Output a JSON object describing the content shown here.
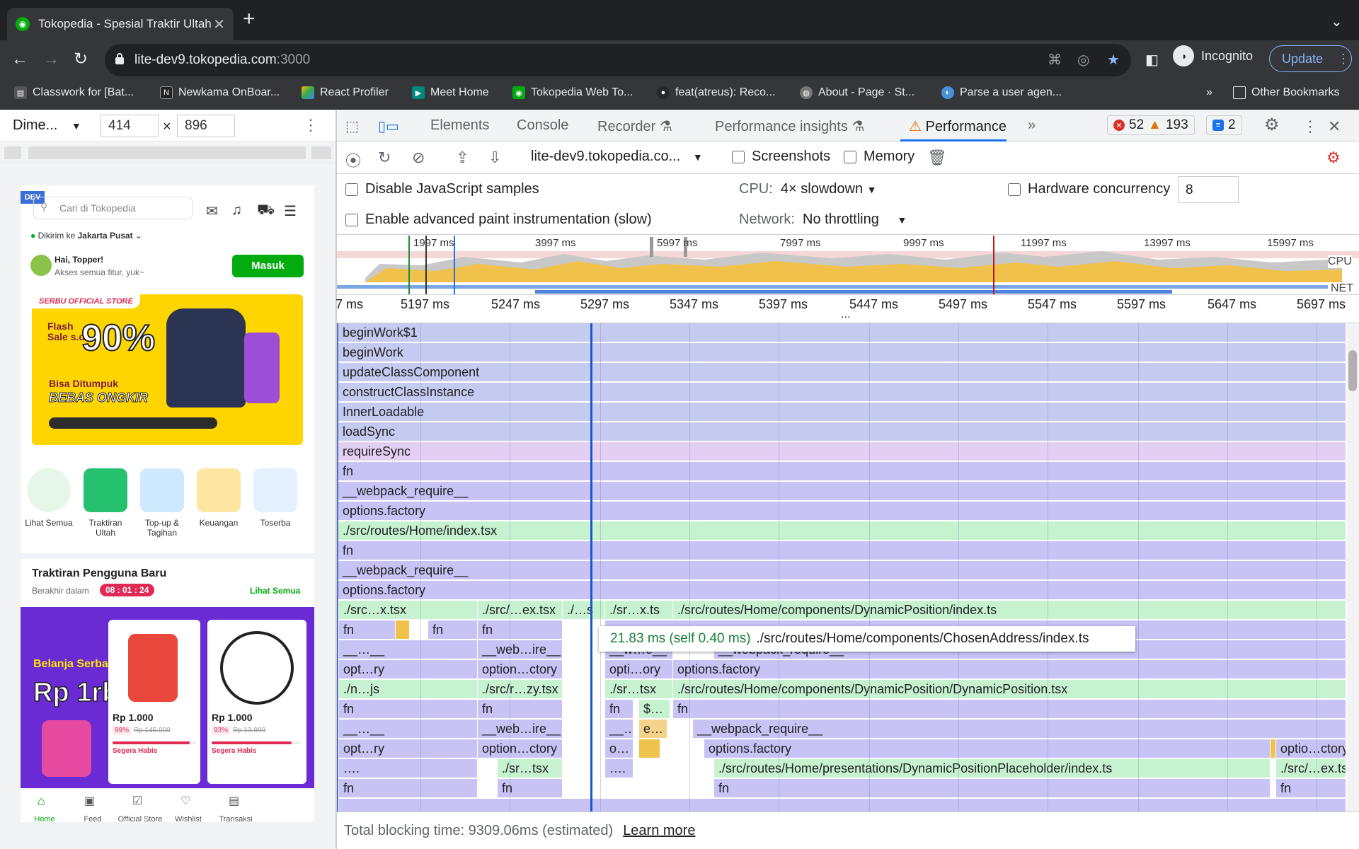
{
  "browser": {
    "tab_title": "Tokopedia - Spesial Traktir Ultah",
    "url_host": "lite-dev9.tokopedia.com",
    "url_port": ":3000",
    "profile": "Incognito",
    "update_label": "Update",
    "bookmarks": [
      "Classwork for [Bat...",
      "Newkama OnBoar...",
      "React Profiler",
      "Meet Home",
      "Tokopedia Web To...",
      "feat(atreus): Reco...",
      "About - Page · St...",
      "Parse a user agen..."
    ],
    "other_bookmarks": "Other Bookmarks",
    "overflow": "»"
  },
  "emulation": {
    "device": "Dime...",
    "width": "414",
    "height": "896",
    "times": "×"
  },
  "phone": {
    "dev_tag": "DEV",
    "search_placeholder": "Cari di Tokopedia",
    "deliver_prefix": "Dikirim ke",
    "deliver_city": "Jakarta Pusat",
    "greeting": "Hai, Topper!",
    "greeting_sub": "Akses semua fitur, yuk~",
    "login": "Masuk",
    "banner_tag": "SERBU OFFICIAL STORE",
    "banner_flash": "Flash Sale s.d.",
    "banner_percent": "90%",
    "banner_line1": "Bisa Ditumpuk",
    "banner_line2": "BEBAS ONGKIR",
    "categories": [
      "Lihat Semua",
      "Traktiran Ultah",
      "Top-up & Tagihan",
      "Keuangan",
      "Toserba"
    ],
    "section_title": "Traktiran Pengguna Baru",
    "section_sub": "Berakhir dalam",
    "timer": "08 : 01 : 24",
    "see_all": "Lihat Semua",
    "promo_title": "Belanja Serba",
    "promo_big": "Rp 1rb",
    "products": [
      {
        "price": "Rp 1.000",
        "discount": "99%",
        "old": "Rp 145.000",
        "status": "Segera Habis"
      },
      {
        "price": "Rp 1.000",
        "discount": "93%",
        "old": "Rp 13.999",
        "status": "Segera Habis"
      }
    ],
    "bottom_nav": [
      "Home",
      "Feed",
      "Official Store",
      "Wishlist",
      "Transaksi"
    ]
  },
  "devtools": {
    "tabs": [
      "Elements",
      "Console",
      "Recorder",
      "Performance insights",
      "Performance"
    ],
    "more": "»",
    "errors": "52",
    "warnings": "193",
    "messages": "2",
    "profile_select": "lite-dev9.tokopedia.co...",
    "screenshots": "Screenshots",
    "memory": "Memory",
    "disable_js": "Disable JavaScript samples",
    "advanced_paint": "Enable advanced paint instrumentation (slow)",
    "cpu_label": "CPU:",
    "cpu_value": "4× slowdown",
    "network_label": "Network:",
    "network_value": "No throttling",
    "hw_concurrency": "Hardware concurrency",
    "hw_value": "8",
    "overview_ticks": [
      "1997 ms",
      "3997 ms",
      "5997 ms",
      "7997 ms",
      "9997 ms",
      "11997 ms",
      "13997 ms",
      "15997 ms"
    ],
    "overview_cpu": "CPU",
    "overview_net": "NET",
    "ruler_ticks": [
      "7 ms",
      "5197 ms",
      "5247 ms",
      "5297 ms",
      "5347 ms",
      "5397 ms",
      "5447 ms",
      "5497 ms",
      "5547 ms",
      "5597 ms",
      "5647 ms",
      "5697 ms"
    ],
    "ellipsis": "...",
    "flame_rows": [
      "beginWork$1",
      "beginWork",
      "updateClassComponent",
      "constructClassInstance",
      "InnerLoadable",
      "loadSync",
      "requireSync",
      "fn",
      "__webpack_require__",
      "options.factory",
      "./src/routes/Home/index.tsx",
      "fn",
      "__webpack_require__",
      "options.factory"
    ],
    "frags": {
      "r14": [
        "./src…x.tsx",
        "./src/…ex.tsx",
        "./…s",
        "./sr…x.ts",
        "./src/routes/Home/components/DynamicPosition/index.ts"
      ],
      "r15": [
        "fn",
        "fn",
        "fn"
      ],
      "r16": [
        "__…__",
        "__web…ire__",
        "__w…e__",
        "__webpack_require__"
      ],
      "r17": [
        "opt…ry",
        "option…ctory",
        "opti…ory",
        "options.factory"
      ],
      "r18": [
        "./n…js",
        "./src/r…zy.tsx",
        "./sr…tsx",
        "./src/routes/Home/components/DynamicPosition/DynamicPosition.tsx"
      ],
      "r19": [
        "fn",
        "fn",
        "fn",
        "$…",
        "fn"
      ],
      "r20": [
        "__…__",
        "__web…ire__",
        "__…",
        "e…",
        "__webpack_require__"
      ],
      "r21": [
        "opt…ry",
        "option…ctory",
        "o…",
        "options.factory",
        "optio…ctory"
      ],
      "r22": [
        "….",
        "./sr…tsx",
        "….",
        "./src/routes/Home/presentations/DynamicPositionPlaceholder/index.ts",
        "./src/…ex.ts"
      ],
      "r23": [
        "fn",
        "fn",
        "fn",
        "fn"
      ]
    },
    "tooltip_time": "21.83 ms (self 0.40 ms)",
    "tooltip_path": "./src/routes/Home/components/ChosenAddress/index.ts",
    "footer_text": "Total blocking time: 9309.06ms (estimated)",
    "learn_more": "Learn more"
  },
  "colors": {
    "accent": "#1a73e8",
    "flame_blue": "#c5cbf0",
    "flame_purple": "#c7c3f5",
    "flame_green": "#c6f2cf",
    "flame_pink": "#e3cff2",
    "tokopedia_green": "#03ac0e"
  }
}
